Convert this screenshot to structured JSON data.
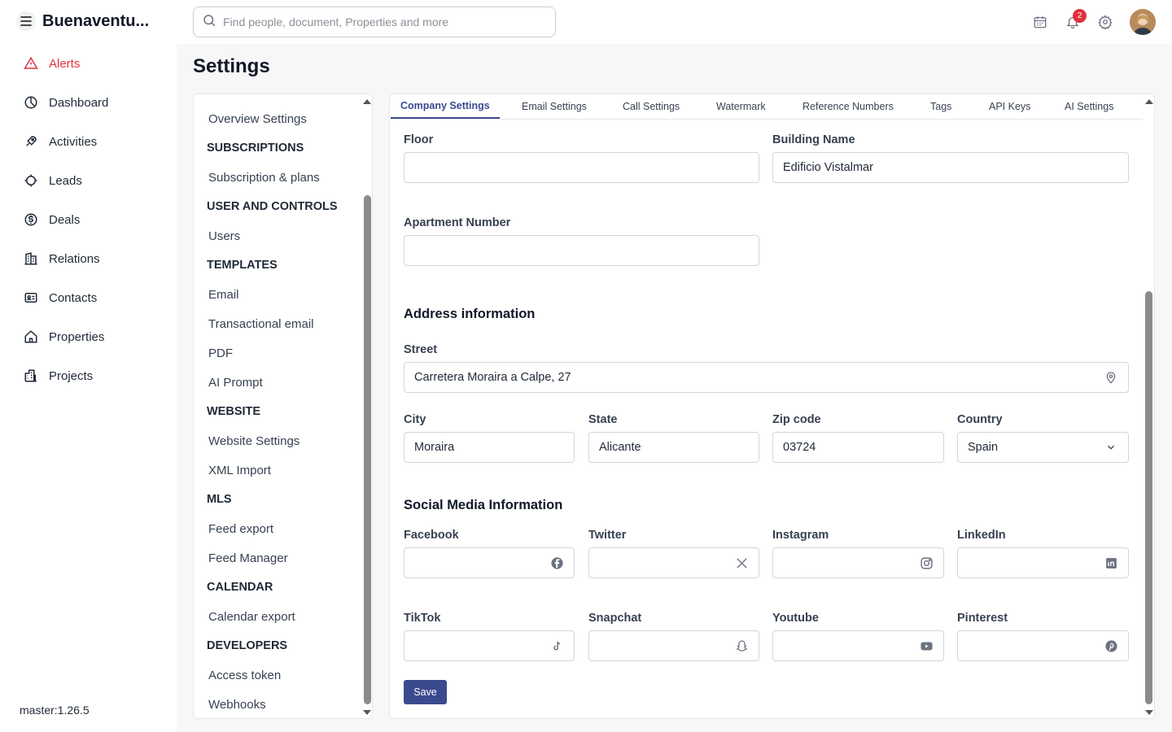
{
  "app": {
    "brand": "Buenaventu...",
    "version": "master:1.26.5"
  },
  "nav": [
    {
      "label": "Alerts",
      "icon": "alert-triangle-icon"
    },
    {
      "label": "Dashboard",
      "icon": "pie-chart-icon"
    },
    {
      "label": "Activities",
      "icon": "rocket-icon"
    },
    {
      "label": "Leads",
      "icon": "target-icon"
    },
    {
      "label": "Deals",
      "icon": "dollar-circle-icon"
    },
    {
      "label": "Relations",
      "icon": "building-icon"
    },
    {
      "label": "Contacts",
      "icon": "id-card-icon"
    },
    {
      "label": "Properties",
      "icon": "home-icon"
    },
    {
      "label": "Projects",
      "icon": "buildings-icon"
    }
  ],
  "search": {
    "placeholder": "Find people, document, Properties and more"
  },
  "notifications": {
    "count": "2"
  },
  "page": {
    "title": "Settings"
  },
  "settings_menu": {
    "overview": "Overview Settings",
    "subscriptions_head": "SUBSCRIPTIONS",
    "subscription_plans": "Subscription & plans",
    "user_controls_head": "USER AND CONTROLS",
    "users": "Users",
    "templates_head": "TEMPLATES",
    "email": "Email",
    "transactional_email": "Transactional email",
    "pdf": "PDF",
    "ai_prompt": "AI Prompt",
    "website_head": "WEBSITE",
    "website_settings": "Website Settings",
    "xml_import": "XML Import",
    "mls_head": "MLS",
    "feed_export": "Feed export",
    "feed_manager": "Feed Manager",
    "calendar_head": "CALENDAR",
    "calendar_export": "Calendar export",
    "developers_head": "DEVELOPERS",
    "access_token": "Access token",
    "webhooks": "Webhooks"
  },
  "tabs": {
    "company": "Company Settings",
    "email": "Email Settings",
    "call": "Call Settings",
    "watermark": "Watermark",
    "reference": "Reference Numbers",
    "tags": "Tags",
    "api": "API Keys",
    "ai": "AI Settings"
  },
  "form": {
    "floor": {
      "label": "Floor",
      "value": ""
    },
    "building": {
      "label": "Building Name",
      "value": "Edificio Vistalmar"
    },
    "apartment": {
      "label": "Apartment Number",
      "value": ""
    },
    "address_title": "Address information",
    "street": {
      "label": "Street",
      "value": "Carretera Moraira a Calpe, 27"
    },
    "city": {
      "label": "City",
      "value": "Moraira"
    },
    "state": {
      "label": "State",
      "value": "Alicante"
    },
    "zip": {
      "label": "Zip code",
      "value": "03724"
    },
    "country": {
      "label": "Country",
      "value": "Spain"
    },
    "social_title": "Social Media Information",
    "facebook": {
      "label": "Facebook",
      "value": ""
    },
    "twitter": {
      "label": "Twitter",
      "value": ""
    },
    "instagram": {
      "label": "Instagram",
      "value": ""
    },
    "linkedin": {
      "label": "LinkedIn",
      "value": ""
    },
    "tiktok": {
      "label": "TikTok",
      "value": ""
    },
    "snapchat": {
      "label": "Snapchat",
      "value": ""
    },
    "youtube": {
      "label": "Youtube",
      "value": ""
    },
    "pinterest": {
      "label": "Pinterest",
      "value": ""
    },
    "save": "Save"
  },
  "colors": {
    "accent": "#3b4a8f",
    "alert": "#e0313d"
  }
}
